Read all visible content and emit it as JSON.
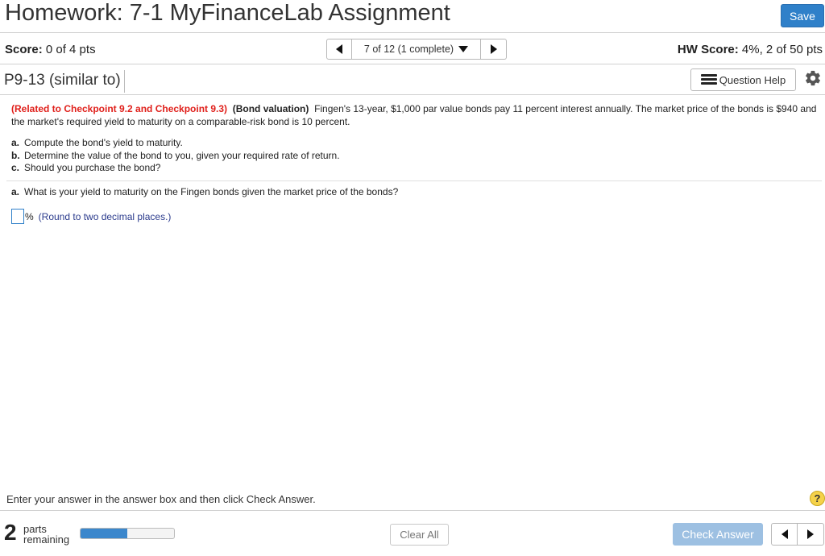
{
  "header": {
    "title": "Homework: 7-1 MyFinanceLab Assignment",
    "save_label": "Save"
  },
  "scorebar": {
    "score_label": "Score:",
    "score_value": "0 of 4 pts",
    "question_nav": "7 of 12 (1 complete)",
    "hw_score_label": "HW Score:",
    "hw_score_value": "4%, 2 of 50 pts"
  },
  "question": {
    "id": "P9-13 (similar to)",
    "help_label": "Question Help",
    "related": "(Related to Checkpoint 9.2 and Checkpoint 9.3)",
    "topic": "(Bond valuation)",
    "body": "Fingen's 13-year, $1,000 par value bonds pay 11 percent interest annually.  The market price of the bonds is $940 and the market's required yield to maturity on a comparable-risk bond is 10 percent.",
    "parts": [
      {
        "letter": "a.",
        "text": "Compute the bond's yield to maturity."
      },
      {
        "letter": "b.",
        "text": "Determine the value of the bond to you, given your required rate of return."
      },
      {
        "letter": "c.",
        "text": "Should you purchase the bond?"
      }
    ],
    "current_letter": "a.",
    "current_text": "What is your yield to maturity on the Fingen bonds given the market price of the bonds?",
    "answer_unit": "%",
    "answer_hint": "(Round to two decimal places.)"
  },
  "footer": {
    "instruction": "Enter your answer in the answer box and then click Check Answer.",
    "help_glyph": "?",
    "parts_count": "2",
    "parts_line1": "parts",
    "parts_line2": "remaining",
    "progress_fraction": 0.5,
    "clear_label": "Clear All",
    "check_label": "Check Answer"
  },
  "colors": {
    "accent": "#2f80c9",
    "related_red": "#e0201b",
    "hint_blue": "#2a3a8c"
  }
}
